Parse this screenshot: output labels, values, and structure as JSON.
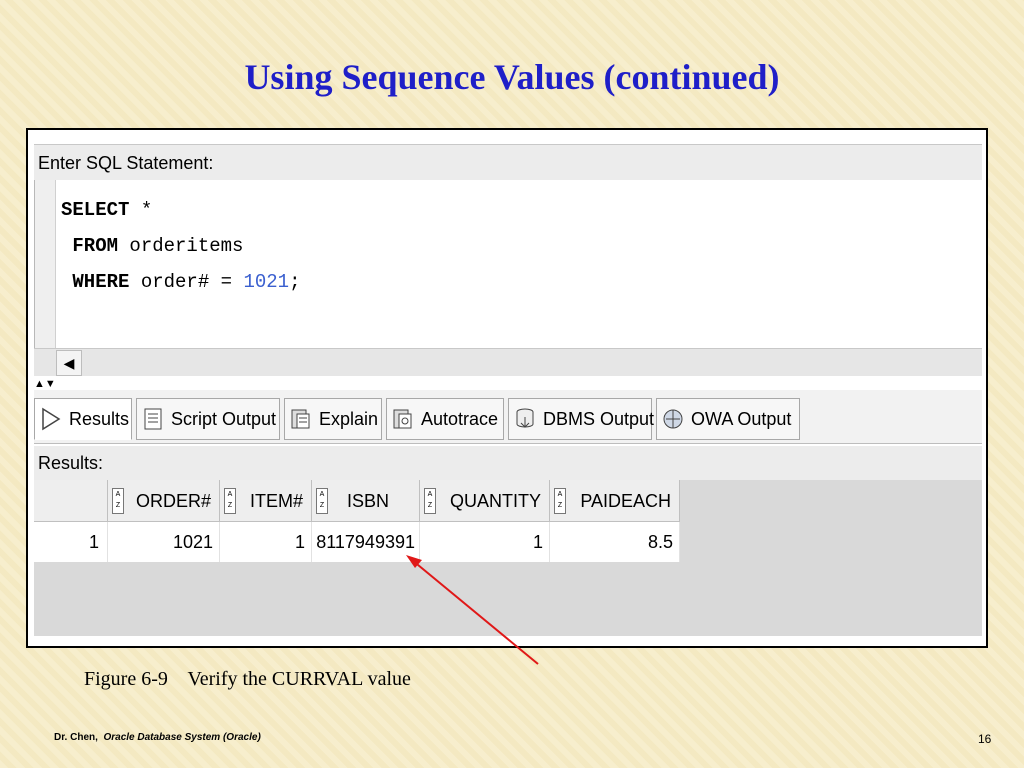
{
  "slide": {
    "title": "Using Sequence Values (continued)",
    "caption": "Figure 6-9    Verify the CURRVAL value",
    "footer_author": "Dr. Chen,",
    "footer_course": "Oracle Database System  (Oracle)",
    "page_number": "16"
  },
  "sql_editor": {
    "header": "Enter SQL Statement:",
    "line1_kw": "SELECT",
    "line1_rest": " *",
    "line2_kw": "FROM",
    "line2_rest": " orderitems",
    "line3_kw": "WHERE",
    "line3_mid": " order# = ",
    "line3_num": "1021",
    "line3_end": ";"
  },
  "tabs": [
    {
      "label": "Results",
      "icon": "play-icon",
      "active": true
    },
    {
      "label": "Script Output",
      "icon": "script-icon"
    },
    {
      "label": "Explain",
      "icon": "explain-icon"
    },
    {
      "label": "Autotrace",
      "icon": "autotrace-icon"
    },
    {
      "label": "DBMS Output",
      "icon": "dbms-icon"
    },
    {
      "label": "OWA Output",
      "icon": "owa-icon"
    }
  ],
  "results": {
    "label": "Results:",
    "columns": [
      "ORDER#",
      "ITEM#",
      "ISBN",
      "QUANTITY",
      "PAIDEACH"
    ],
    "rows": [
      {
        "row_num": "1",
        "order": "1021",
        "item": "1",
        "isbn": "8117949391",
        "quantity": "1",
        "paideach": "8.5"
      }
    ]
  },
  "colors": {
    "title": "#1f1fc8",
    "annotation_arrow": "#e01818",
    "sql_number": "#3a5fcf"
  }
}
